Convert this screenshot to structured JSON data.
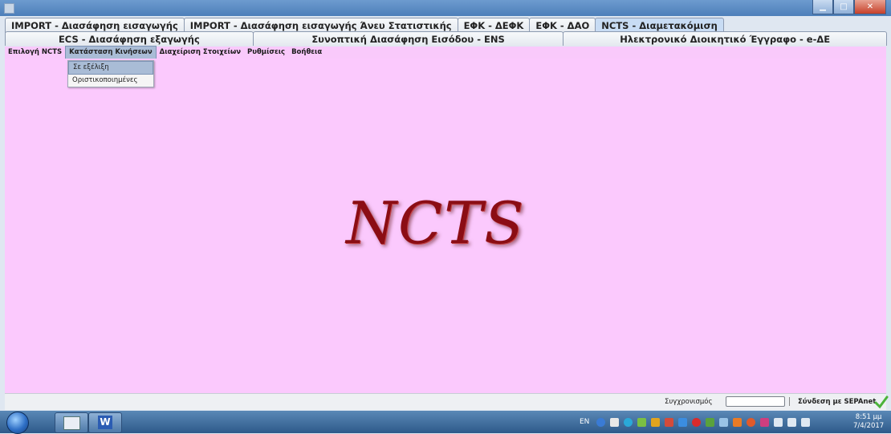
{
  "tabs_row1": [
    {
      "label": "IMPORT - Διασάφηση εισαγωγής",
      "active": false
    },
    {
      "label": "IMPORT - Διασάφηση εισαγωγής Άνευ Στατιστικής",
      "active": false
    },
    {
      "label": "ΕΦΚ - ΔΕΦΚ",
      "active": false
    },
    {
      "label": "ΕΦΚ - ΔΑΟ",
      "active": false
    },
    {
      "label": "NCTS - Διαμετακόμιση",
      "active": true
    }
  ],
  "tabs_row2": [
    {
      "label": "ECS - Διασάφηση εξαγωγής"
    },
    {
      "label": "Συνοπτική Διασάφηση Εισόδου - ENS"
    },
    {
      "label": "Ηλεκτρονικό Διοικητικό Έγγραφο - e-ΔΕ"
    }
  ],
  "menubar": [
    {
      "label": "Επιλογή NCTS",
      "open": false
    },
    {
      "label": "Κατάσταση Κινήσεων",
      "open": true
    },
    {
      "label": "Διαχείριση Στοιχείων",
      "open": false
    },
    {
      "label": "Ρυθμίσεις",
      "open": false
    },
    {
      "label": "Βοήθεια",
      "open": false
    }
  ],
  "dropdown": [
    {
      "label": "Σε εξέλιξη",
      "selected": true
    },
    {
      "label": "Οριστικοποιημένες",
      "selected": false
    }
  ],
  "logo": {
    "text": "NCTS"
  },
  "statusbar": {
    "sync_label": "Συγχρονισμός",
    "connect_label": "Σύνδεση με SEPAnet"
  },
  "taskbar": {
    "lang": "EN",
    "time": "8:51 μμ",
    "date": "7/4/2017"
  },
  "colors": {
    "content_bg": "#fbc9fd",
    "logo": "#8b0d14"
  }
}
